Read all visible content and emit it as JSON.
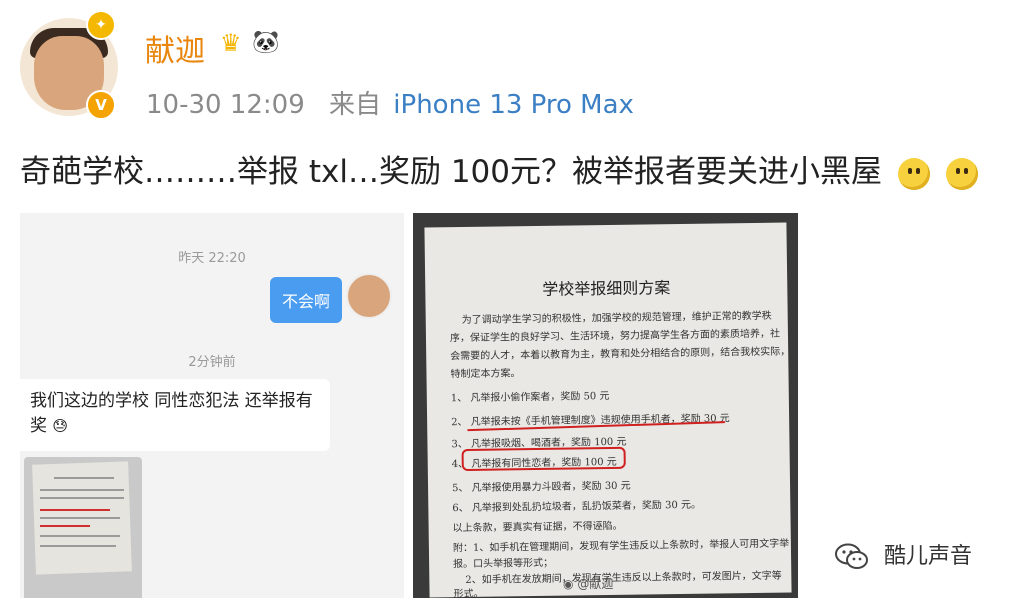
{
  "post": {
    "username": "献迦",
    "time": "10-30 12:09",
    "from_label": "来自",
    "device": "iPhone 13 Pro Max",
    "text": "奇葩学校………举报 txl…奖励 100元？被举报者要关进小黑屋"
  },
  "chat": {
    "time1": "昨天 22:20",
    "right_message": "不会啊",
    "time2": "2分钟前",
    "left_message": "我们这边的学校 同性恋犯法 还举报有奖"
  },
  "document": {
    "title": "学校举报细则方案",
    "intro_lines": [
      "为了调动学生学习的积极性，加强学校的规范管理，维护正常的教学秩",
      "序，保证学生的良好学习、生活环境，努力提高学生各方面的素质培养，社",
      "会需要的人才，本着以教育为主，教育和处分相结合的原则，结合我校实际，",
      "特制定本方案。"
    ],
    "items": [
      "1、  凡举报小偷作案者，奖励 50 元",
      "2、  凡举报未按《手机管理制度》违规使用手机者，奖励 30 元",
      "3、  凡举报吸烟、喝酒者，奖励 100 元",
      "4、  凡举报有同性恋者，奖励 100 元",
      "5、  凡举报使用暴力斗殴者，奖励 30 元",
      "6、  凡举报到处乱扔垃圾者，乱扔饭菜者，奖励 30 元。",
      "以上条款，要真实有证据，不得诬陷。",
      "附：1、如手机在管理期间，发现有学生违反以上条款时，举报人可用文字举",
      "报。口头举报等形式；",
      "2、如手机在发放期间，发现有学生违反以上条款时，可发图片，文字等",
      "形式。"
    ],
    "watermark": "@献迦"
  },
  "footer": {
    "wechat_account": "酷儿声音"
  },
  "colors": {
    "username": "#e8860e",
    "device_link": "#3b7fc4",
    "chat_bubble_right": "#4a9cf0",
    "red_markup": "#d02020"
  }
}
